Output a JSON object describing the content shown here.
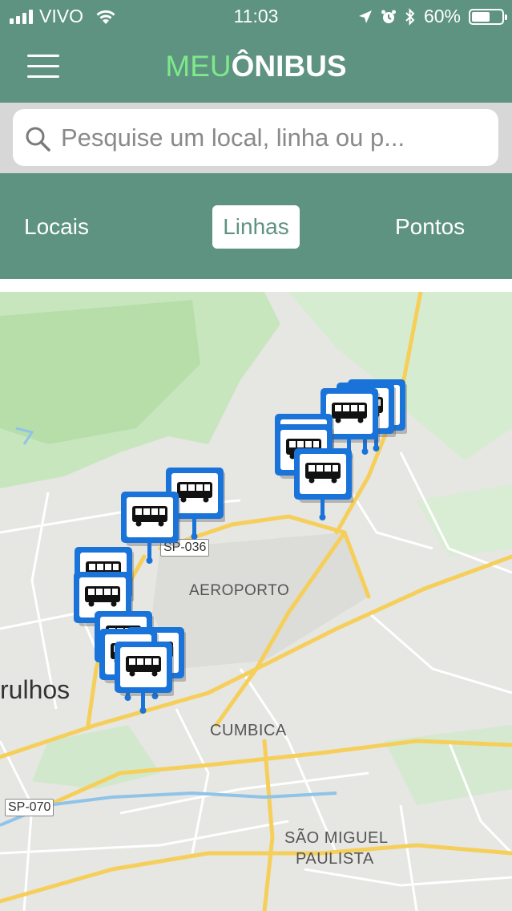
{
  "status_bar": {
    "carrier": "VIVO",
    "time": "11:03",
    "battery": "60%",
    "battery_level": 0.6,
    "icons": [
      "signal-icon",
      "wifi-icon",
      "location-icon",
      "alarm-icon",
      "bluetooth-icon",
      "battery-icon"
    ]
  },
  "header": {
    "brand_part1": "MEU",
    "brand_part2": "ÔNIBUS",
    "menu_icon": "hamburger-menu-icon",
    "colors": {
      "bar": "#5d9380",
      "brand_accent": "#7ee88a"
    }
  },
  "search": {
    "placeholder": "Pesquise um local, linha ou p...",
    "value": ""
  },
  "tabs": [
    {
      "label": "Locais",
      "selected": false
    },
    {
      "label": "Linhas",
      "selected": true
    },
    {
      "label": "Pontos",
      "selected": false
    }
  ],
  "map": {
    "labels": {
      "aeroporto": "AEROPORTO",
      "cumbica": "CUMBICA",
      "sao_miguel_1": "SÃO MIGUEL",
      "sao_miguel_2": "PAULISTA",
      "guarulhos": "rulhos"
    },
    "road_badges": {
      "sp036": "SP-036",
      "sp070": "SP-070"
    },
    "marker_icon": "bus-stop-icon",
    "marker_color": "#1a73d9"
  }
}
